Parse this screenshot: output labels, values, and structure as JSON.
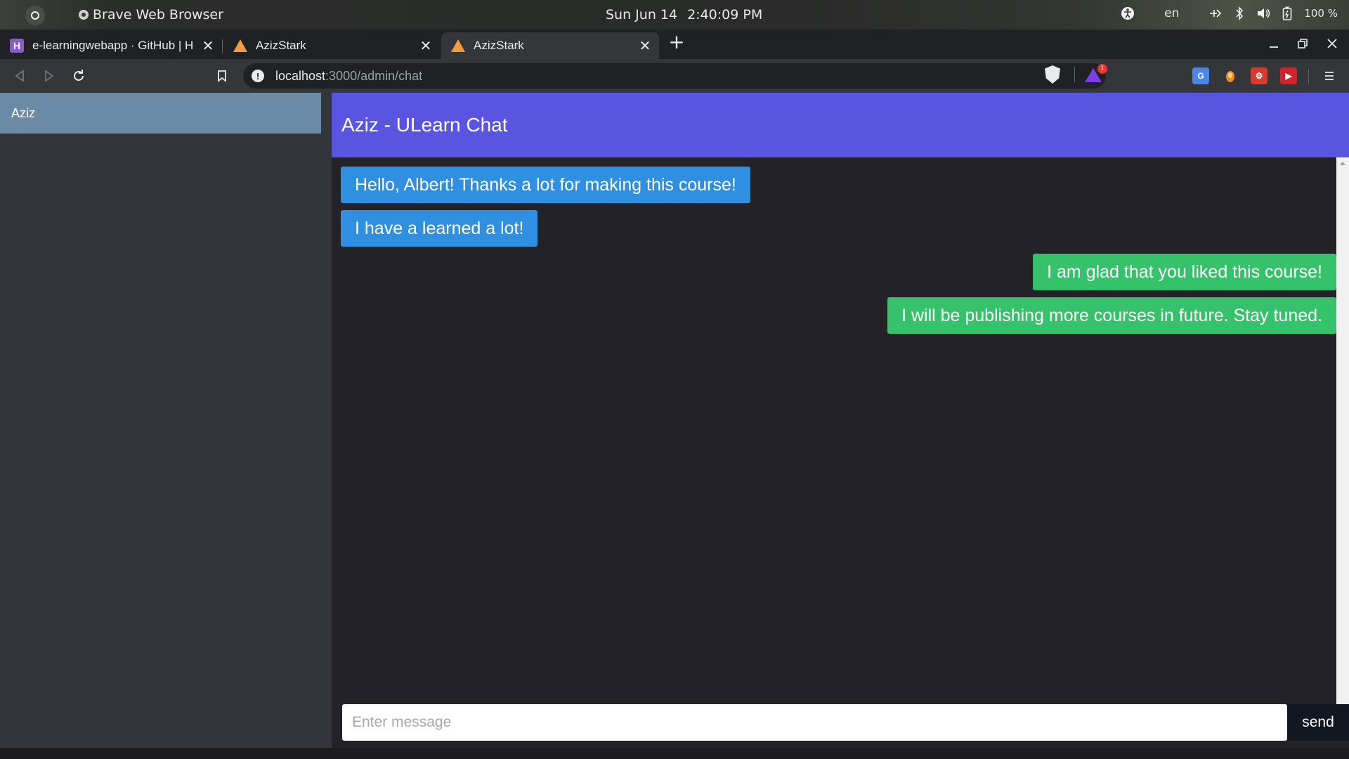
{
  "os": {
    "app_name": "Brave Web Browser",
    "date": "Sun Jun 14",
    "time": "2:40:09 PM",
    "language": "en",
    "battery": "100 %"
  },
  "browser": {
    "tabs": [
      {
        "title": "e-learningwebapp · GitHub | H",
        "favicon": "github-favicon"
      },
      {
        "title": "AzizStark",
        "favicon": "warning-triangle-favicon"
      },
      {
        "title": "AzizStark",
        "favicon": "warning-triangle-favicon",
        "active": true
      }
    ],
    "url_host": "localhost",
    "url_path": ":3000/admin/chat",
    "rewards_badge": "1",
    "icons": [
      "back-icon",
      "forward-icon",
      "reload-icon",
      "bookmark-icon",
      "site-info-icon",
      "brave-shield-icon",
      "brave-rewards-icon",
      "translate-extension-icon",
      "extension-icon",
      "extension-icon",
      "extension-icon",
      "menu-icon"
    ]
  },
  "sidebar": {
    "contacts": [
      {
        "name": "Aziz"
      }
    ]
  },
  "chat": {
    "title": "Aziz - ULearn Chat",
    "messages": [
      {
        "text": "Hello, Albert! Thanks a lot for making this course!",
        "direction": "incoming"
      },
      {
        "text": "I have a learned a lot!",
        "direction": "incoming"
      },
      {
        "text": "I am glad that you liked this course!",
        "direction": "outgoing"
      },
      {
        "text": "I will be publishing more courses in future. Stay tuned.",
        "direction": "outgoing"
      }
    ],
    "input_placeholder": "Enter message",
    "send_label": "send"
  },
  "colors": {
    "header": "#5a55e0",
    "incoming": "#2f8fe0",
    "outgoing": "#36c26a",
    "contact_selected": "#6a8aa6",
    "sidebar": "#34353b",
    "chat_bg": "#222228"
  }
}
